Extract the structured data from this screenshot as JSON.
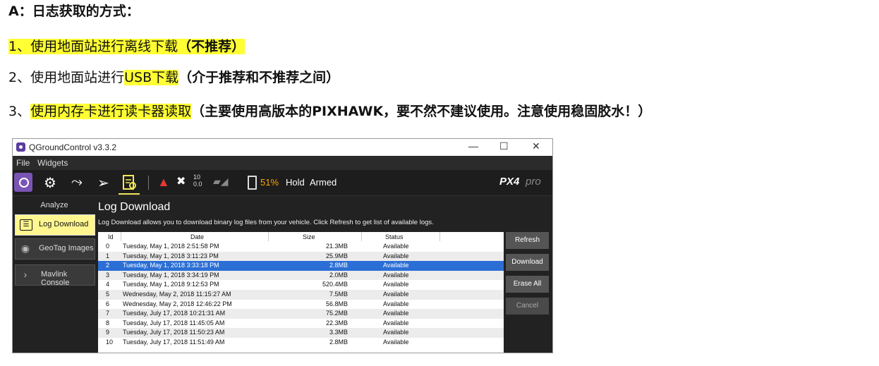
{
  "doc": {
    "heading_a": "A：",
    "heading_text": "日志获取的方式：",
    "line1_num": "1、",
    "line1_text": "使用地面站进行离线下载",
    "line1_bold": "（不推荐）",
    "line2_num": "2、",
    "line2_text": "使用地面站进行",
    "line2_hl": "USB下载",
    "line2_bold": "（介于推荐和不推荐之间）",
    "line3_num": "3、",
    "line3_hl": "使用内存卡进行读卡器读取",
    "line3_bold": "（主要使用高版本的PIXHAWK，要不然不建议使用。注意使用稳固胶水！）"
  },
  "window": {
    "title": "QGroundControl v3.3.2",
    "minimize": "—",
    "maximize": "☐",
    "close": "✕"
  },
  "menu": {
    "file": "File",
    "widgets": "Widgets"
  },
  "toolbar": {
    "gps_count": "10",
    "gps_hdop": "0.0",
    "battery": "51%",
    "mode": "Hold",
    "armed": "Armed",
    "logo": "PX4",
    "logo_suffix": "pro"
  },
  "sidebar": {
    "title": "Analyze",
    "items": [
      {
        "label": "Log Download",
        "icon": "list-icon"
      },
      {
        "label": "GeoTag Images",
        "icon": "location-pin-icon"
      },
      {
        "label": "Mavlink Console",
        "icon": "chevron-right-icon"
      }
    ]
  },
  "main": {
    "title": "Log Download",
    "description": "Log Download allows you to download binary log files from your vehicle. Click Refresh to get list of available logs.",
    "columns": {
      "id": "Id",
      "date": "Date",
      "size": "Size",
      "status": "Status"
    },
    "rows": [
      {
        "id": "0",
        "date": "Tuesday, May 1, 2018 2:51:58 PM",
        "size": "21.3MB",
        "status": "Available"
      },
      {
        "id": "1",
        "date": "Tuesday, May 1, 2018 3:11:23 PM",
        "size": "25.9MB",
        "status": "Available"
      },
      {
        "id": "2",
        "date": "Tuesday, May 1, 2018 3:33:18 PM",
        "size": "2.8MB",
        "status": "Available"
      },
      {
        "id": "3",
        "date": "Tuesday, May 1, 2018 3:34:19 PM",
        "size": "2.0MB",
        "status": "Available"
      },
      {
        "id": "4",
        "date": "Tuesday, May 1, 2018 9:12:53 PM",
        "size": "520.4MB",
        "status": "Available"
      },
      {
        "id": "5",
        "date": "Wednesday, May 2, 2018 11:15:27 AM",
        "size": "7.5MB",
        "status": "Available"
      },
      {
        "id": "6",
        "date": "Wednesday, May 2, 2018 12:46:22 PM",
        "size": "56.8MB",
        "status": "Available"
      },
      {
        "id": "7",
        "date": "Tuesday, July 17, 2018 10:21:31 AM",
        "size": "75.2MB",
        "status": "Available"
      },
      {
        "id": "8",
        "date": "Tuesday, July 17, 2018 11:45:05 AM",
        "size": "22.3MB",
        "status": "Available"
      },
      {
        "id": "9",
        "date": "Tuesday, July 17, 2018 11:50:23 AM",
        "size": "3.3MB",
        "status": "Available"
      },
      {
        "id": "10",
        "date": "Tuesday, July 17, 2018 11:51:49 AM",
        "size": "2.8MB",
        "status": "Available"
      }
    ],
    "selected_row": "2",
    "buttons": {
      "refresh": "Refresh",
      "download": "Download",
      "erase_all": "Erase All",
      "cancel": "Cancel"
    }
  },
  "colors": {
    "highlight": "#ffff33",
    "selection": "#2b6fd6",
    "active_tab": "#fff68f",
    "battery": "#ffa500",
    "warning": "#e53935"
  }
}
